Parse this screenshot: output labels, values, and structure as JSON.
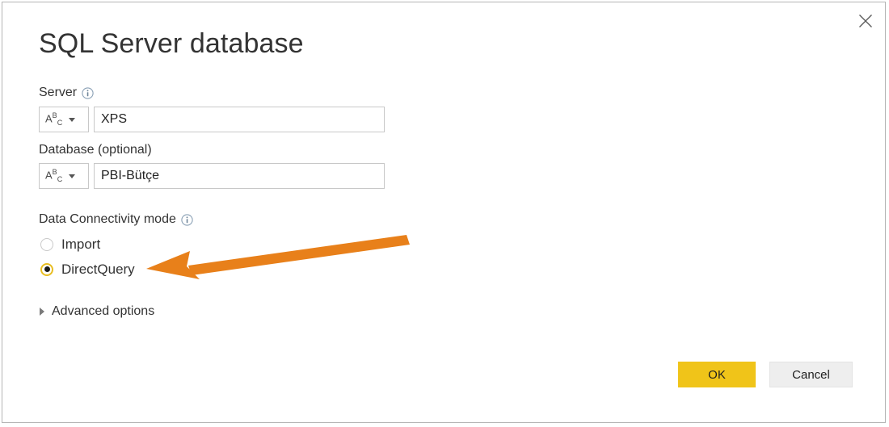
{
  "dialog": {
    "title": "SQL Server database",
    "close_icon": "close-icon"
  },
  "fields": {
    "server": {
      "label": "Server",
      "info_icon": "info-icon",
      "type_picker": {
        "glyph_a": "A",
        "glyph_b": "B",
        "glyph_c": "C",
        "caret_icon": "chevron-down-icon"
      },
      "value": "XPS",
      "placeholder": ""
    },
    "database": {
      "label": "Database (optional)",
      "type_picker": {
        "glyph_a": "A",
        "glyph_b": "B",
        "glyph_c": "C",
        "caret_icon": "chevron-down-icon"
      },
      "value": "PBI-Bütçe",
      "placeholder": ""
    }
  },
  "connectivity": {
    "label": "Data Connectivity mode",
    "info_icon": "info-icon",
    "options": [
      {
        "label": "Import",
        "selected": false
      },
      {
        "label": "DirectQuery",
        "selected": true
      }
    ]
  },
  "advanced": {
    "label": "Advanced options",
    "chevron_icon": "chevron-right-icon",
    "expanded": false
  },
  "footer": {
    "ok_label": "OK",
    "cancel_label": "Cancel"
  },
  "annotation": {
    "arrow_icon": "arrow-left-annotation",
    "color": "#E8801A"
  },
  "colors": {
    "accent_yellow": "#F0C419",
    "annotation_orange": "#E8801A",
    "border_gray": "#C8C8C8",
    "text_dark": "#333333",
    "info_blue": "#7A8FA6"
  }
}
